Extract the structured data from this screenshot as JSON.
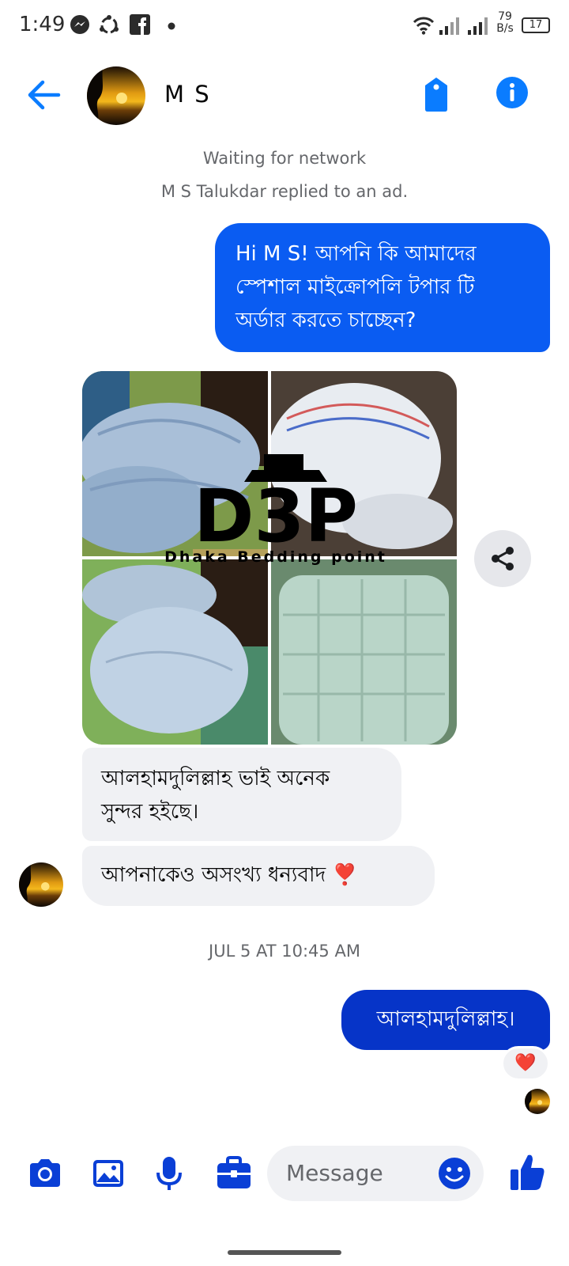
{
  "status_bar": {
    "time": "1:49",
    "net_speed_value": "79",
    "net_speed_unit": "B/s",
    "battery": "17",
    "icons": [
      "messenger-icon",
      "sync-icon",
      "facebook-icon",
      "dot-icon",
      "wifi-icon",
      "signal-icon",
      "battery-icon"
    ]
  },
  "header": {
    "contact_name": "M S",
    "icons": [
      "back-arrow-icon",
      "tag-icon",
      "info-icon"
    ]
  },
  "conversation": {
    "network_status": "Waiting for network",
    "ad_reply_note": "M S Talukdar replied to an ad.",
    "outgoing_first": {
      "line1": "Hi M S! আপনি কি আমাদের",
      "line2": "স্পেশাল মাইক্রোপলি টপার টি",
      "line3": "অর্ডার করতে চাচ্ছেন?"
    },
    "photo_collage": {
      "tile_count": 4,
      "watermark_text": "D3P",
      "watermark_sub": "Dhaka Bedding point"
    },
    "incoming_1": {
      "line1": "আলহামদুলিল্লাহ ভাই অনেক",
      "line2": "সুন্দর হইছে।"
    },
    "incoming_2": {
      "text": "আপনাকেও অসংখ্য ধন্যবাদ",
      "emoji": "❣️"
    },
    "timestamp": "JUL 5 AT 10:45 AM",
    "outgoing_last": {
      "text": "আলহামদুলিল্লাহ।",
      "reaction": "❤️"
    }
  },
  "composer": {
    "placeholder": "Message",
    "icons": [
      "camera-icon",
      "gallery-icon",
      "microphone-icon",
      "briefcase-icon",
      "emoji-icon",
      "thumbs-up-icon"
    ]
  },
  "colors": {
    "accent": "#0a7cff",
    "outgoing_bubble": "#0a5cf2",
    "outgoing_bubble_dark": "#0634c8",
    "incoming_bubble": "#f0f1f4",
    "composer_icon": "#0a3fd6",
    "meta_text": "#65676b"
  }
}
